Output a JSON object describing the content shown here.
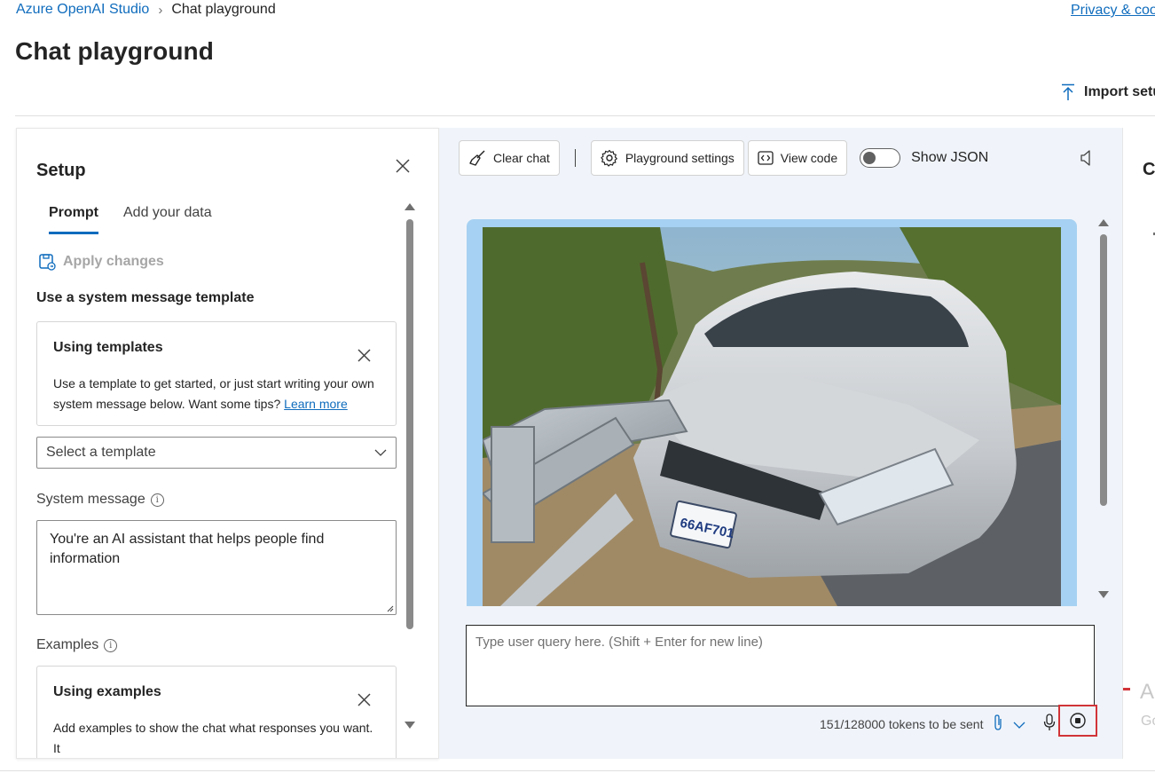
{
  "breadcrumb": {
    "root": "Azure OpenAI Studio",
    "current": "Chat playground"
  },
  "header": {
    "privacy_link": "Privacy & coo",
    "title": "Chat playground",
    "import_label": "Import setu"
  },
  "setup": {
    "title": "Setup",
    "tabs": [
      {
        "label": "Prompt"
      },
      {
        "label": "Add your data"
      }
    ],
    "apply_changes": "Apply changes",
    "template_heading": "Use a system message template",
    "templates_card": {
      "title": "Using templates",
      "body": "Use a template to get started, or just start writing your own system message below. Want some tips?",
      "link": "Learn more"
    },
    "select_template": {
      "value": "Select a template"
    },
    "system_message_label": "System message",
    "system_message_value": "You're an AI assistant that helps people find information",
    "examples_label": "Examples",
    "examples_card": {
      "title": "Using examples",
      "body": "Add examples to show the chat what responses you want. It"
    }
  },
  "chat": {
    "toolbar": {
      "clear_chat": "Clear chat",
      "playground_settings": "Playground settings",
      "view_code": "View code",
      "show_json": "Show JSON",
      "show_json_on": false
    },
    "image": {
      "plate": "66AF701"
    },
    "query_placeholder": "Type user query here. (Shift + Enter for new line)",
    "tokens": "151/128000 tokens to be sent"
  },
  "right_panel": {
    "heading": "Co",
    "big_text": "A",
    "small_text": "Go"
  },
  "colors": {
    "accent": "#0f6cbd",
    "chat_bg": "#f0f4fa",
    "highlight": "#d13438",
    "image_frame": "#a7d1f2"
  }
}
